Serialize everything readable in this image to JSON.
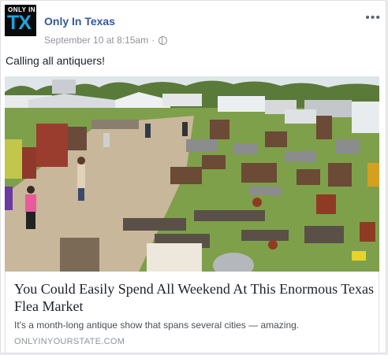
{
  "post": {
    "page_name": "Only In Texas",
    "avatar": {
      "line1": "ONLY IN",
      "line2": "TX",
      "brand_color": "#1fa3e0"
    },
    "timestamp": "September 10 at 8:15am",
    "separator": "·",
    "privacy_icon": "globe-icon",
    "more_icon": "ellipsis-icon",
    "text": "Calling all antiquers!"
  },
  "link": {
    "title": "You Could Easily Spend All Weekend At This Enormous Texas Flea Market",
    "description": "It's a month-long antique show that spans several cities — amazing.",
    "domain": "ONLYINYOURSTATE.COM"
  },
  "photo": {
    "subject": "outdoor flea market with antiques"
  }
}
